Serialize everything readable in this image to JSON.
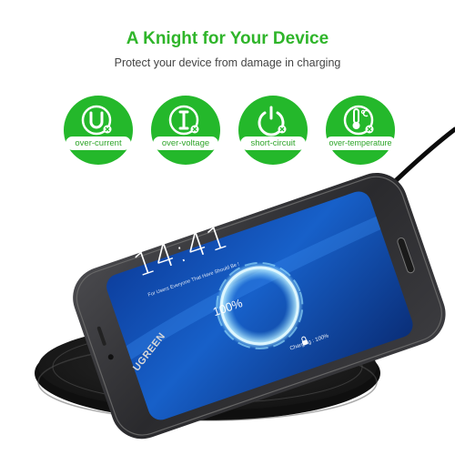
{
  "header": {
    "title": "A Knight for Your Device",
    "subtitle": "Protect your device from damage in charging"
  },
  "features": [
    {
      "label": "over-current",
      "icon": "over-current-icon"
    },
    {
      "label": "over-voltage",
      "icon": "over-voltage-icon"
    },
    {
      "label": "short-circuit",
      "icon": "short-circuit-icon"
    },
    {
      "label": "over-temperature",
      "icon": "over-temperature-icon"
    }
  ],
  "product": {
    "brand": "UGREEN",
    "screen": {
      "clock": "14:41",
      "lock_message": "For Users Everyone That Have Should Be !",
      "battery_percent": "100%",
      "charging_status": "Charging : 100%"
    }
  },
  "colors": {
    "accent_green": "#24b82b",
    "title_green": "#2fb52a",
    "pad_black": "#1b1b1b",
    "screen_blue": "#1760c9"
  }
}
